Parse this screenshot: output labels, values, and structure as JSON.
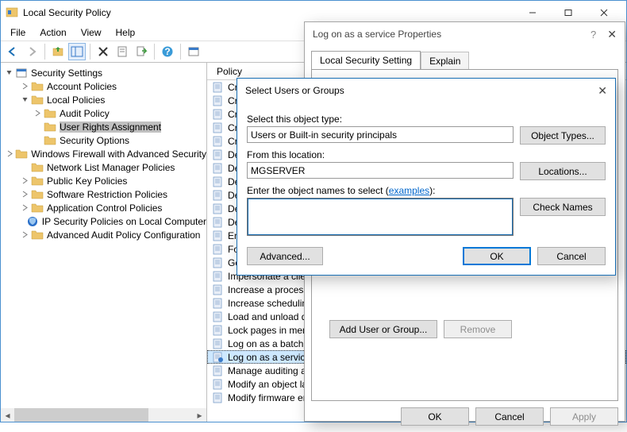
{
  "titlebar": {
    "title": "Local Security Policy"
  },
  "menubar": [
    "File",
    "Action",
    "View",
    "Help"
  ],
  "tree": {
    "root": "Security Settings",
    "items": [
      {
        "label": "Account Policies",
        "depth": 1,
        "exp": ">"
      },
      {
        "label": "Local Policies",
        "depth": 1,
        "exp": "v"
      },
      {
        "label": "Audit Policy",
        "depth": 2,
        "exp": ">"
      },
      {
        "label": "User Rights Assignment",
        "depth": 2,
        "exp": "",
        "selected": true
      },
      {
        "label": "Security Options",
        "depth": 2,
        "exp": ""
      },
      {
        "label": "Windows Firewall with Advanced Security",
        "depth": 1,
        "exp": ">"
      },
      {
        "label": "Network List Manager Policies",
        "depth": 1,
        "exp": ""
      },
      {
        "label": "Public Key Policies",
        "depth": 1,
        "exp": ">"
      },
      {
        "label": "Software Restriction Policies",
        "depth": 1,
        "exp": ">"
      },
      {
        "label": "Application Control Policies",
        "depth": 1,
        "exp": ">"
      },
      {
        "label": "IP Security Policies on Local Computer",
        "depth": 1,
        "exp": "",
        "special": true
      },
      {
        "label": "Advanced Audit Policy Configuration",
        "depth": 1,
        "exp": ">"
      }
    ]
  },
  "list": {
    "header": "Policy",
    "items": [
      "Create a pagefile",
      "Create a token object",
      "Create global objects",
      "Create permanent shared objects",
      "Create symbolic links",
      "Debug programs",
      "Deny access to this computer from the network",
      "Deny log on as a batch job",
      "Deny log on as a service",
      "Deny log on locally",
      "Deny log on through Remote Desktop Services",
      "Enable computer and user accounts to be trusted for delegation",
      "Force shutdown from a remote system",
      "Generate security audits",
      "Impersonate a client after authentication",
      "Increase a process working set",
      "Increase scheduling priority",
      "Load and unload device drivers",
      "Lock pages in memory",
      "Log on as a batch job",
      "Log on as a service",
      "Manage auditing and security log",
      "Modify an object label",
      "Modify firmware environment values"
    ],
    "selected_index": 20
  },
  "props": {
    "title": "Log on as a service Properties",
    "tabs": {
      "active": "Local Security Setting",
      "inactive": "Explain"
    },
    "add_btn": "Add User or Group...",
    "remove_btn": "Remove",
    "ok": "OK",
    "cancel": "Cancel",
    "apply": "Apply"
  },
  "select": {
    "title": "Select Users or Groups",
    "object_type_label": "Select this object type:",
    "object_type_value": "Users or Built-in security principals",
    "object_types_btn": "Object Types...",
    "location_label": "From this location:",
    "location_value": "MGSERVER",
    "locations_btn": "Locations...",
    "names_label_a": "Enter the object names to select (",
    "names_label_link": "examples",
    "names_label_b": "):",
    "check_names_btn": "Check Names",
    "advanced_btn": "Advanced...",
    "ok": "OK",
    "cancel": "Cancel"
  }
}
